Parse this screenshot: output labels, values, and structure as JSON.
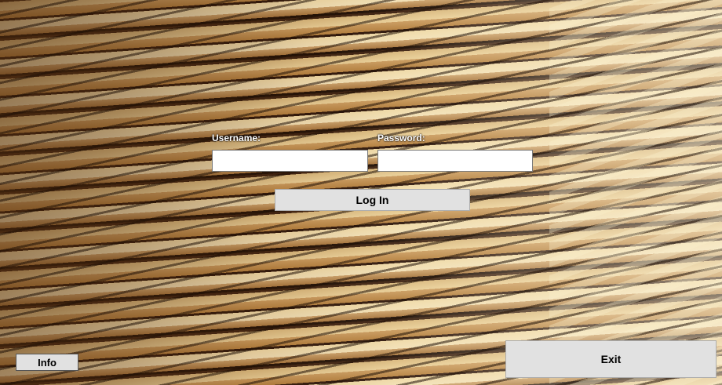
{
  "login_form": {
    "username_label": "Username:",
    "username_value": "",
    "password_label": "Password:",
    "password_value": "",
    "login_button_label": "Log In"
  },
  "footer": {
    "info_button_label": "Info",
    "exit_button_label": "Exit"
  },
  "background": {
    "image": "wall-of-books"
  }
}
